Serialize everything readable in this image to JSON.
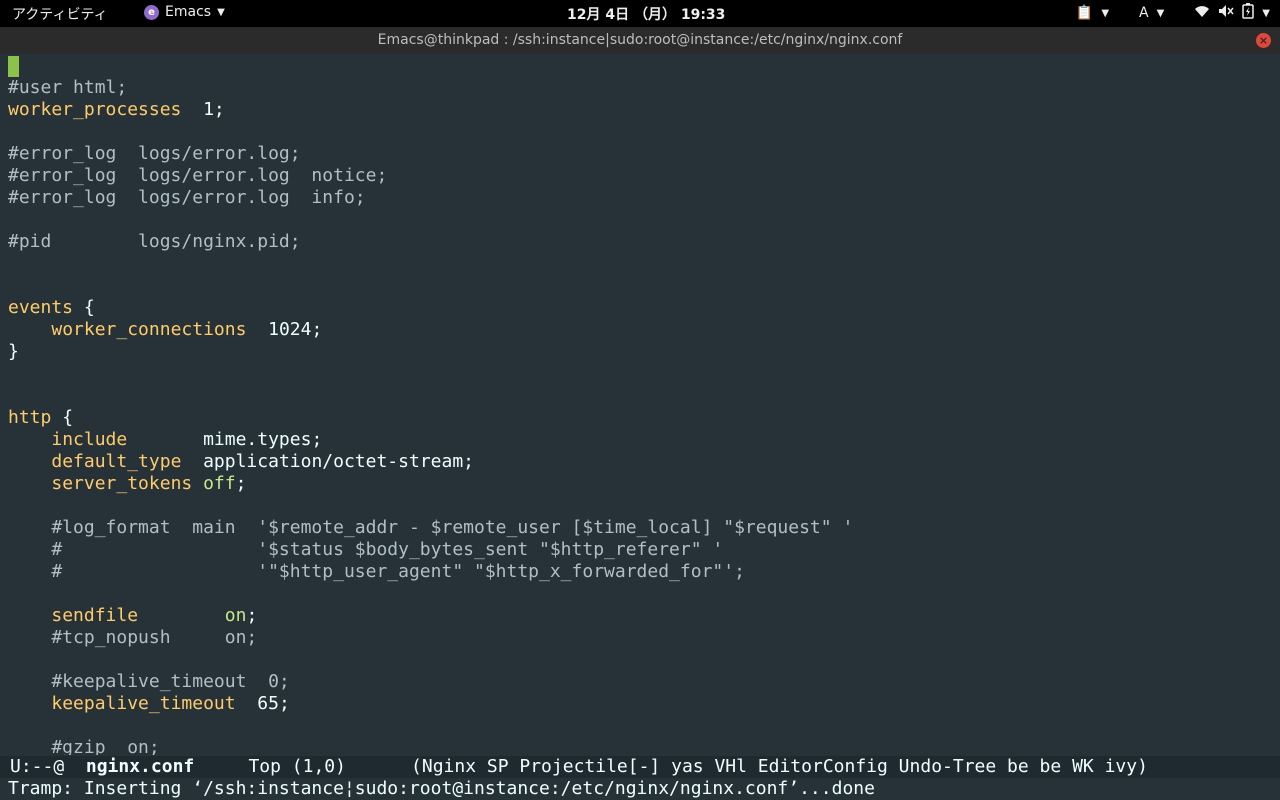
{
  "topbar": {
    "activities": "アクティビティ",
    "app_name": "Emacs",
    "clock": "12月  4日 （月） 19:33",
    "input_method": "A"
  },
  "window": {
    "title": "Emacs@thinkpad : /ssh:instance|sudo:root@instance:/etc/nginx/nginx.conf"
  },
  "editor": {
    "lines": [
      [
        {
          "t": "#user html;",
          "c": "cm"
        }
      ],
      [
        {
          "t": "worker_processes",
          "c": "kw"
        },
        {
          "t": "  1;",
          "c": "txt"
        }
      ],
      [],
      [
        {
          "t": "#error_log  logs/error.log;",
          "c": "cm"
        }
      ],
      [
        {
          "t": "#error_log  logs/error.log  notice;",
          "c": "cm"
        }
      ],
      [
        {
          "t": "#error_log  logs/error.log  info;",
          "c": "cm"
        }
      ],
      [],
      [
        {
          "t": "#pid        logs/nginx.pid;",
          "c": "cm"
        }
      ],
      [],
      [],
      [
        {
          "t": "events",
          "c": "kw"
        },
        {
          "t": " {",
          "c": "txt"
        }
      ],
      [
        {
          "t": "    ",
          "c": "txt"
        },
        {
          "t": "worker_connections",
          "c": "kw"
        },
        {
          "t": "  1024;",
          "c": "txt"
        }
      ],
      [
        {
          "t": "}",
          "c": "txt"
        }
      ],
      [],
      [],
      [
        {
          "t": "http",
          "c": "kw"
        },
        {
          "t": " {",
          "c": "txt"
        }
      ],
      [
        {
          "t": "    ",
          "c": "txt"
        },
        {
          "t": "include",
          "c": "kw"
        },
        {
          "t": "       mime.types;",
          "c": "txt"
        }
      ],
      [
        {
          "t": "    ",
          "c": "txt"
        },
        {
          "t": "default_type",
          "c": "kw"
        },
        {
          "t": "  application/octet-stream;",
          "c": "txt"
        }
      ],
      [
        {
          "t": "    ",
          "c": "txt"
        },
        {
          "t": "server_tokens",
          "c": "kw"
        },
        {
          "t": " ",
          "c": "txt"
        },
        {
          "t": "off",
          "c": "val"
        },
        {
          "t": ";",
          "c": "txt"
        }
      ],
      [],
      [
        {
          "t": "    #log_format  main  '$remote_addr - $remote_user [$time_local] \"$request\" '",
          "c": "cm"
        }
      ],
      [
        {
          "t": "    #                  '$status $body_bytes_sent \"$http_referer\" '",
          "c": "cm"
        }
      ],
      [
        {
          "t": "    #                  '\"$http_user_agent\" \"$http_x_forwarded_for\"';",
          "c": "cm"
        }
      ],
      [],
      [
        {
          "t": "    ",
          "c": "txt"
        },
        {
          "t": "sendfile",
          "c": "kw"
        },
        {
          "t": "        ",
          "c": "txt"
        },
        {
          "t": "on",
          "c": "val"
        },
        {
          "t": ";",
          "c": "txt"
        }
      ],
      [
        {
          "t": "    #tcp_nopush     on;",
          "c": "cm"
        }
      ],
      [],
      [
        {
          "t": "    #keepalive_timeout  0;",
          "c": "cm"
        }
      ],
      [
        {
          "t": "    ",
          "c": "txt"
        },
        {
          "t": "keepalive_timeout",
          "c": "kw"
        },
        {
          "t": "  65;",
          "c": "txt"
        }
      ],
      [],
      [
        {
          "t": "    #gzip  on;",
          "c": "cm"
        }
      ]
    ]
  },
  "modeline": {
    "status": "U:--@",
    "buffer_name": "nginx.conf",
    "position": "Top (1,0)",
    "modes": "(Nginx SP Projectile[-] yas VHl EditorConfig Undo-Tree be be WK ivy)"
  },
  "echo_area": {
    "message": "Tramp: Inserting ‘/ssh:instance¦sudo:root@instance:/etc/nginx/nginx.conf’...done"
  },
  "colors": {
    "background": "#263238",
    "keyword": "#ffcb6b",
    "comment": "#b0bec5",
    "value": "#c3e88d",
    "cursor": "#8bc34a"
  }
}
